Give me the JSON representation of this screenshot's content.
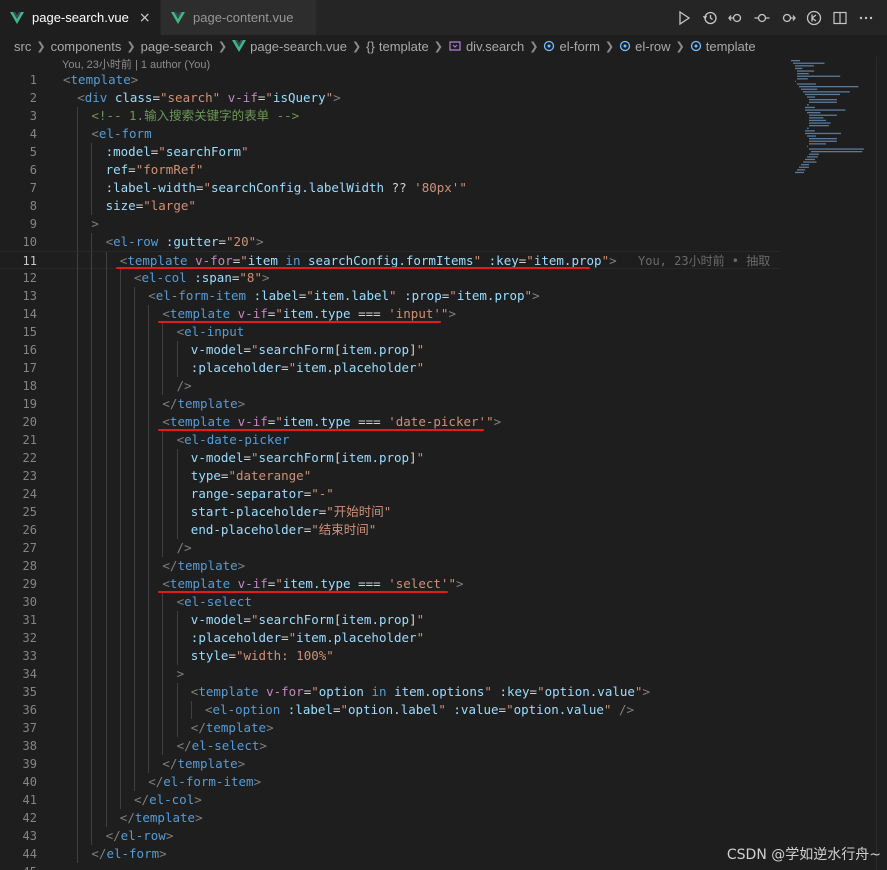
{
  "tabs": [
    {
      "label": "page-search.vue",
      "active": true,
      "close": "×"
    },
    {
      "label": "page-content.vue",
      "active": false
    }
  ],
  "breadcrumb": {
    "items": [
      "src",
      "components",
      "page-search",
      "page-search.vue",
      "template",
      "div.search",
      "el-form",
      "el-row",
      "template"
    ],
    "template_prefix": "{}"
  },
  "codelens": "You, 23小时前 | 1 author (You)",
  "blame": "You, 23小时前 • 抽取",
  "watermark": "CSDN @学如逆水行舟~",
  "colors": {
    "accent": "#e51b1b",
    "vue": "#41b883",
    "tag": "#569cd6",
    "attr": "#9cdcfe",
    "string": "#ce9178"
  },
  "lines": [
    {
      "n": "1",
      "indent": 0,
      "tokens": [
        [
          "t-p",
          "<"
        ],
        [
          "t-tag",
          "template"
        ],
        [
          "t-p",
          ">"
        ]
      ]
    },
    {
      "n": "2",
      "indent": 1,
      "tokens": [
        [
          "t-p",
          "<"
        ],
        [
          "t-tag",
          "div"
        ],
        [
          "t-txt",
          " "
        ],
        [
          "t-attr",
          "class"
        ],
        [
          "t-txt",
          "="
        ],
        [
          "t-str",
          "\"search\""
        ],
        [
          "t-txt",
          " "
        ],
        [
          "t-dir",
          "v-if"
        ],
        [
          "t-txt",
          "="
        ],
        [
          "t-str",
          "\""
        ],
        [
          "t-attr",
          "isQuery"
        ],
        [
          "t-str",
          "\""
        ],
        [
          "t-p",
          ">"
        ]
      ]
    },
    {
      "n": "3",
      "indent": 2,
      "tokens": [
        [
          "t-com",
          "<!-- 1.输入搜索关键字的表单 -->"
        ]
      ]
    },
    {
      "n": "4",
      "indent": 2,
      "tokens": [
        [
          "t-p",
          "<"
        ],
        [
          "t-tag",
          "el-form"
        ]
      ]
    },
    {
      "n": "5",
      "indent": 3,
      "tokens": [
        [
          "t-attr",
          ":model"
        ],
        [
          "t-txt",
          "="
        ],
        [
          "t-str",
          "\""
        ],
        [
          "t-attr",
          "searchForm"
        ],
        [
          "t-str",
          "\""
        ]
      ]
    },
    {
      "n": "6",
      "indent": 3,
      "tokens": [
        [
          "t-attr",
          "ref"
        ],
        [
          "t-txt",
          "="
        ],
        [
          "t-str",
          "\"formRef\""
        ]
      ]
    },
    {
      "n": "7",
      "indent": 3,
      "tokens": [
        [
          "t-attr",
          ":label-width"
        ],
        [
          "t-txt",
          "="
        ],
        [
          "t-str",
          "\""
        ],
        [
          "t-attr",
          "searchConfig.labelWidth"
        ],
        [
          "t-txt",
          " ?? "
        ],
        [
          "t-str",
          "'80px'"
        ],
        [
          "t-str",
          "\""
        ]
      ]
    },
    {
      "n": "8",
      "indent": 3,
      "tokens": [
        [
          "t-attr",
          "size"
        ],
        [
          "t-txt",
          "="
        ],
        [
          "t-str",
          "\"large\""
        ]
      ]
    },
    {
      "n": "9",
      "indent": 2,
      "tokens": [
        [
          "t-p",
          ">"
        ]
      ]
    },
    {
      "n": "10",
      "indent": 3,
      "tokens": [
        [
          "t-p",
          "<"
        ],
        [
          "t-tag",
          "el-row"
        ],
        [
          "t-txt",
          " "
        ],
        [
          "t-attr",
          ":gutter"
        ],
        [
          "t-txt",
          "="
        ],
        [
          "t-str",
          "\"20\""
        ],
        [
          "t-p",
          ">"
        ]
      ]
    },
    {
      "n": "11",
      "indent": 4,
      "tokens": [
        [
          "t-p",
          "<"
        ],
        [
          "t-tag",
          "template"
        ],
        [
          "t-txt",
          " "
        ],
        [
          "t-dir",
          "v-for"
        ],
        [
          "t-txt",
          "="
        ],
        [
          "t-str",
          "\""
        ],
        [
          "t-attr",
          "item"
        ],
        [
          "t-txt",
          " "
        ],
        [
          "t-tag",
          "in"
        ],
        [
          "t-txt",
          " "
        ],
        [
          "t-attr",
          "searchConfig.formItems"
        ],
        [
          "t-str",
          "\""
        ],
        [
          "t-txt",
          " "
        ],
        [
          "t-attr",
          ":key"
        ],
        [
          "t-txt",
          "="
        ],
        [
          "t-str",
          "\""
        ],
        [
          "t-attr",
          "item.prop"
        ],
        [
          "t-str",
          "\""
        ],
        [
          "t-p",
          ">"
        ]
      ]
    },
    {
      "n": "12",
      "indent": 5,
      "tokens": [
        [
          "t-p",
          "<"
        ],
        [
          "t-tag",
          "el-col"
        ],
        [
          "t-txt",
          " "
        ],
        [
          "t-attr",
          ":span"
        ],
        [
          "t-txt",
          "="
        ],
        [
          "t-str",
          "\"8\""
        ],
        [
          "t-p",
          ">"
        ]
      ]
    },
    {
      "n": "13",
      "indent": 6,
      "tokens": [
        [
          "t-p",
          "<"
        ],
        [
          "t-tag",
          "el-form-item"
        ],
        [
          "t-txt",
          " "
        ],
        [
          "t-attr",
          ":label"
        ],
        [
          "t-txt",
          "="
        ],
        [
          "t-str",
          "\""
        ],
        [
          "t-attr",
          "item.label"
        ],
        [
          "t-str",
          "\""
        ],
        [
          "t-txt",
          " "
        ],
        [
          "t-attr",
          ":prop"
        ],
        [
          "t-txt",
          "="
        ],
        [
          "t-str",
          "\""
        ],
        [
          "t-attr",
          "item.prop"
        ],
        [
          "t-str",
          "\""
        ],
        [
          "t-p",
          ">"
        ]
      ]
    },
    {
      "n": "14",
      "indent": 7,
      "tokens": [
        [
          "t-p",
          "<"
        ],
        [
          "t-tag",
          "template"
        ],
        [
          "t-txt",
          " "
        ],
        [
          "t-dir",
          "v-if"
        ],
        [
          "t-txt",
          "="
        ],
        [
          "t-str",
          "\""
        ],
        [
          "t-attr",
          "item.type"
        ],
        [
          "t-txt",
          " === "
        ],
        [
          "t-str",
          "'input'"
        ],
        [
          "t-str",
          "\""
        ],
        [
          "t-p",
          ">"
        ]
      ]
    },
    {
      "n": "15",
      "indent": 8,
      "tokens": [
        [
          "t-p",
          "<"
        ],
        [
          "t-tag",
          "el-input"
        ]
      ]
    },
    {
      "n": "16",
      "indent": 9,
      "tokens": [
        [
          "t-attr",
          "v-model"
        ],
        [
          "t-txt",
          "="
        ],
        [
          "t-str",
          "\""
        ],
        [
          "t-attr",
          "searchForm"
        ],
        [
          "t-txt",
          "["
        ],
        [
          "t-attr",
          "item.prop"
        ],
        [
          "t-txt",
          "]"
        ],
        [
          "t-str",
          "\""
        ]
      ]
    },
    {
      "n": "17",
      "indent": 9,
      "tokens": [
        [
          "t-attr",
          ":placeholder"
        ],
        [
          "t-txt",
          "="
        ],
        [
          "t-str",
          "\""
        ],
        [
          "t-attr",
          "item.placeholder"
        ],
        [
          "t-str",
          "\""
        ]
      ]
    },
    {
      "n": "18",
      "indent": 8,
      "tokens": [
        [
          "t-p",
          "/>"
        ]
      ]
    },
    {
      "n": "19",
      "indent": 7,
      "tokens": [
        [
          "t-p",
          "</"
        ],
        [
          "t-tag",
          "template"
        ],
        [
          "t-p",
          ">"
        ]
      ]
    },
    {
      "n": "20",
      "indent": 7,
      "tokens": [
        [
          "t-p",
          "<"
        ],
        [
          "t-tag",
          "template"
        ],
        [
          "t-txt",
          " "
        ],
        [
          "t-dir",
          "v-if"
        ],
        [
          "t-txt",
          "="
        ],
        [
          "t-str",
          "\""
        ],
        [
          "t-attr",
          "item.type"
        ],
        [
          "t-txt",
          " === "
        ],
        [
          "t-str",
          "'date-picker'"
        ],
        [
          "t-str",
          "\""
        ],
        [
          "t-p",
          ">"
        ]
      ]
    },
    {
      "n": "21",
      "indent": 8,
      "tokens": [
        [
          "t-p",
          "<"
        ],
        [
          "t-tag",
          "el-date-picker"
        ]
      ]
    },
    {
      "n": "22",
      "indent": 9,
      "tokens": [
        [
          "t-attr",
          "v-model"
        ],
        [
          "t-txt",
          "="
        ],
        [
          "t-str",
          "\""
        ],
        [
          "t-attr",
          "searchForm"
        ],
        [
          "t-txt",
          "["
        ],
        [
          "t-attr",
          "item.prop"
        ],
        [
          "t-txt",
          "]"
        ],
        [
          "t-str",
          "\""
        ]
      ]
    },
    {
      "n": "23",
      "indent": 9,
      "tokens": [
        [
          "t-attr",
          "type"
        ],
        [
          "t-txt",
          "="
        ],
        [
          "t-str",
          "\"daterange\""
        ]
      ]
    },
    {
      "n": "24",
      "indent": 9,
      "tokens": [
        [
          "t-attr",
          "range-separator"
        ],
        [
          "t-txt",
          "="
        ],
        [
          "t-str",
          "\"-\""
        ]
      ]
    },
    {
      "n": "25",
      "indent": 9,
      "tokens": [
        [
          "t-attr",
          "start-placeholder"
        ],
        [
          "t-txt",
          "="
        ],
        [
          "t-str",
          "\"开始时间\""
        ]
      ]
    },
    {
      "n": "26",
      "indent": 9,
      "tokens": [
        [
          "t-attr",
          "end-placeholder"
        ],
        [
          "t-txt",
          "="
        ],
        [
          "t-str",
          "\"结束时间\""
        ]
      ]
    },
    {
      "n": "27",
      "indent": 8,
      "tokens": [
        [
          "t-p",
          "/>"
        ]
      ]
    },
    {
      "n": "28",
      "indent": 7,
      "tokens": [
        [
          "t-p",
          "</"
        ],
        [
          "t-tag",
          "template"
        ],
        [
          "t-p",
          ">"
        ]
      ]
    },
    {
      "n": "29",
      "indent": 7,
      "tokens": [
        [
          "t-p",
          "<"
        ],
        [
          "t-tag",
          "template"
        ],
        [
          "t-txt",
          " "
        ],
        [
          "t-dir",
          "v-if"
        ],
        [
          "t-txt",
          "="
        ],
        [
          "t-str",
          "\""
        ],
        [
          "t-attr",
          "item.type"
        ],
        [
          "t-txt",
          " === "
        ],
        [
          "t-str",
          "'select'"
        ],
        [
          "t-str",
          "\""
        ],
        [
          "t-p",
          ">"
        ]
      ]
    },
    {
      "n": "30",
      "indent": 8,
      "tokens": [
        [
          "t-p",
          "<"
        ],
        [
          "t-tag",
          "el-select"
        ]
      ]
    },
    {
      "n": "31",
      "indent": 9,
      "tokens": [
        [
          "t-attr",
          "v-model"
        ],
        [
          "t-txt",
          "="
        ],
        [
          "t-str",
          "\""
        ],
        [
          "t-attr",
          "searchForm"
        ],
        [
          "t-txt",
          "["
        ],
        [
          "t-attr",
          "item.prop"
        ],
        [
          "t-txt",
          "]"
        ],
        [
          "t-str",
          "\""
        ]
      ]
    },
    {
      "n": "32",
      "indent": 9,
      "tokens": [
        [
          "t-attr",
          ":placeholder"
        ],
        [
          "t-txt",
          "="
        ],
        [
          "t-str",
          "\""
        ],
        [
          "t-attr",
          "item.placeholder"
        ],
        [
          "t-str",
          "\""
        ]
      ]
    },
    {
      "n": "33",
      "indent": 9,
      "tokens": [
        [
          "t-attr",
          "style"
        ],
        [
          "t-txt",
          "="
        ],
        [
          "t-str",
          "\"width: 100%\""
        ]
      ]
    },
    {
      "n": "34",
      "indent": 8,
      "tokens": [
        [
          "t-p",
          ">"
        ]
      ]
    },
    {
      "n": "35",
      "indent": 9,
      "tokens": [
        [
          "t-p",
          "<"
        ],
        [
          "t-tag",
          "template"
        ],
        [
          "t-txt",
          " "
        ],
        [
          "t-dir",
          "v-for"
        ],
        [
          "t-txt",
          "="
        ],
        [
          "t-str",
          "\""
        ],
        [
          "t-attr",
          "option"
        ],
        [
          "t-txt",
          " "
        ],
        [
          "t-tag",
          "in"
        ],
        [
          "t-txt",
          " "
        ],
        [
          "t-attr",
          "item.options"
        ],
        [
          "t-str",
          "\""
        ],
        [
          "t-txt",
          " "
        ],
        [
          "t-attr",
          ":key"
        ],
        [
          "t-txt",
          "="
        ],
        [
          "t-str",
          "\""
        ],
        [
          "t-attr",
          "option.value"
        ],
        [
          "t-str",
          "\""
        ],
        [
          "t-p",
          ">"
        ]
      ]
    },
    {
      "n": "36",
      "indent": 10,
      "tokens": [
        [
          "t-p",
          "<"
        ],
        [
          "t-tag",
          "el-option"
        ],
        [
          "t-txt",
          " "
        ],
        [
          "t-attr",
          ":label"
        ],
        [
          "t-txt",
          "="
        ],
        [
          "t-str",
          "\""
        ],
        [
          "t-attr",
          "option.label"
        ],
        [
          "t-str",
          "\""
        ],
        [
          "t-txt",
          " "
        ],
        [
          "t-attr",
          ":value"
        ],
        [
          "t-txt",
          "="
        ],
        [
          "t-str",
          "\""
        ],
        [
          "t-attr",
          "option.value"
        ],
        [
          "t-str",
          "\""
        ],
        [
          "t-txt",
          " "
        ],
        [
          "t-p",
          "/>"
        ]
      ]
    },
    {
      "n": "37",
      "indent": 9,
      "tokens": [
        [
          "t-p",
          "</"
        ],
        [
          "t-tag",
          "template"
        ],
        [
          "t-p",
          ">"
        ]
      ]
    },
    {
      "n": "38",
      "indent": 8,
      "tokens": [
        [
          "t-p",
          "</"
        ],
        [
          "t-tag",
          "el-select"
        ],
        [
          "t-p",
          ">"
        ]
      ]
    },
    {
      "n": "39",
      "indent": 7,
      "tokens": [
        [
          "t-p",
          "</"
        ],
        [
          "t-tag",
          "template"
        ],
        [
          "t-p",
          ">"
        ]
      ]
    },
    {
      "n": "40",
      "indent": 6,
      "tokens": [
        [
          "t-p",
          "</"
        ],
        [
          "t-tag",
          "el-form-item"
        ],
        [
          "t-p",
          ">"
        ]
      ]
    },
    {
      "n": "41",
      "indent": 5,
      "tokens": [
        [
          "t-p",
          "</"
        ],
        [
          "t-tag",
          "el-col"
        ],
        [
          "t-p",
          ">"
        ]
      ]
    },
    {
      "n": "42",
      "indent": 4,
      "tokens": [
        [
          "t-p",
          "</"
        ],
        [
          "t-tag",
          "template"
        ],
        [
          "t-p",
          ">"
        ]
      ]
    },
    {
      "n": "43",
      "indent": 3,
      "tokens": [
        [
          "t-p",
          "</"
        ],
        [
          "t-tag",
          "el-row"
        ],
        [
          "t-p",
          ">"
        ]
      ]
    },
    {
      "n": "44",
      "indent": 2,
      "tokens": [
        [
          "t-p",
          "</"
        ],
        [
          "t-tag",
          "el-form"
        ],
        [
          "t-p",
          ">"
        ]
      ]
    },
    {
      "n": "45",
      "indent": 1,
      "tokens": []
    }
  ],
  "current_line": "11",
  "highlighted_lines": [
    "11",
    "14",
    "20",
    "29"
  ]
}
